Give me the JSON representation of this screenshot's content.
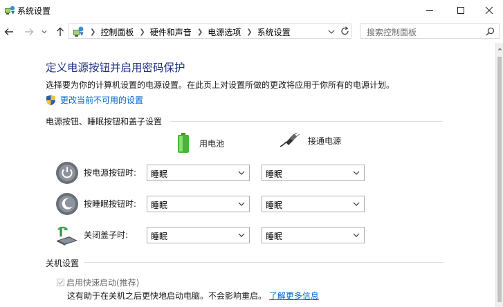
{
  "window": {
    "title": "系统设置"
  },
  "nav": {
    "breadcrumbs": [
      "控制面板",
      "硬件和声音",
      "电源选项",
      "系统设置"
    ],
    "search_placeholder": "搜索控制面板"
  },
  "page": {
    "title": "定义电源按钮并启用密码保护",
    "subtitle": "选择要为你的计算机设置的电源设置。在此页上对设置所做的更改将应用于你所有的电源计划。",
    "admin_link": "更改当前不可用的设置"
  },
  "power_section": {
    "heading": "电源按钮、睡眠按钮和盖子设置",
    "columns": {
      "battery": "用电池",
      "plugged": "接通电源"
    },
    "rows": [
      {
        "label": "按电源按钮时:",
        "battery": "睡眠",
        "plugged": "睡眠"
      },
      {
        "label": "按睡眠按钮时:",
        "battery": "睡眠",
        "plugged": "睡眠"
      },
      {
        "label": "关闭盖子时:",
        "battery": "睡眠",
        "plugged": "睡眠"
      }
    ]
  },
  "shutdown_section": {
    "heading": "关机设置",
    "fast_startup": {
      "label": "启用快速启动(推荐)",
      "checked": true,
      "enabled": false
    },
    "description": "这有助于在关机之后更快地启动电脑。不会影响重启。",
    "learn_more": "了解更多信息"
  },
  "colors": {
    "title_blue": "#1e3287",
    "link_blue": "#0066cc"
  }
}
